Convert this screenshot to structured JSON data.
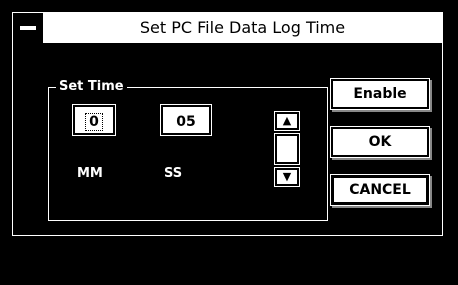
{
  "window": {
    "title": "Set PC File Data Log Time"
  },
  "group": {
    "label": "Set Time"
  },
  "fields": {
    "minutes_value": "0",
    "seconds_value": "05",
    "minutes_label": "MM",
    "seconds_label": "SS"
  },
  "spinner": {
    "up_icon": "arrow-up-icon",
    "down_icon": "arrow-down-icon"
  },
  "buttons": {
    "enable": "Enable",
    "ok": "OK",
    "cancel": "CANCEL"
  }
}
